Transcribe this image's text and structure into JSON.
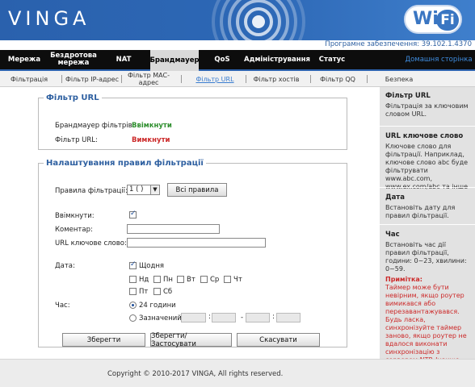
{
  "header": {
    "brand": "VINGA",
    "wifi_logo_wi": "Wi",
    "wifi_logo_fi": "Fi",
    "firmware": "Програмне забезпечення: 39.102.1.4370"
  },
  "topnav": {
    "items": [
      {
        "label": "Мережа"
      },
      {
        "label": "Бездротова мережа"
      },
      {
        "label": "NAT"
      },
      {
        "label": "Брандмауер"
      },
      {
        "label": "QoS"
      },
      {
        "label": "Адміністрування"
      },
      {
        "label": "Статус"
      }
    ],
    "home": "Домашня сторінка"
  },
  "subnav": {
    "items": [
      {
        "label": "Фільтрація"
      },
      {
        "label": "Фільтр IP-адрес"
      },
      {
        "label": "Фільтр MAC-адрес"
      },
      {
        "label": "Фільтр URL"
      },
      {
        "label": "Фільтр хостів"
      },
      {
        "label": "Фільтр QQ"
      },
      {
        "label": "Безпека"
      }
    ]
  },
  "url_filter": {
    "legend": "Фільтр URL",
    "firewall_label": "Брандмауер фільтрів:",
    "firewall_value": "Ввімкнути",
    "filter_label": "Фільтр URL:",
    "filter_value": "Вимкнути"
  },
  "rules": {
    "legend": "Налаштування правил фільтрації",
    "rule_label": "Правила фільтрації:",
    "rule_value": "1 ( )",
    "all_rules_btn": "Всі правила",
    "enable_label": "Ввімкнути:",
    "enable_checked": true,
    "comment_label": "Коментар:",
    "comment_value": "",
    "keyword_label": "URL ключове слово:",
    "keyword_value": "",
    "date_label": "Дата:",
    "daily_label": "Щодня",
    "daily_checked": true,
    "days": [
      "Нд",
      "Пн",
      "Вт",
      "Ср",
      "Чт",
      "Пт",
      "Сб"
    ],
    "time_label": "Час:",
    "time_24h": "24 години",
    "time_24h_selected": true,
    "time_custom": "Зазначений",
    "time_separator_colon": ":",
    "time_separator_dash": "-",
    "save_btn": "Зберегти",
    "save_apply_btn": "Зберегти/Застосувати",
    "cancel_btn": "Скасувати"
  },
  "help": {
    "sections": [
      {
        "title": "Фільтр URL",
        "text": "Фільтрація за ключовим словом URL."
      },
      {
        "title": "URL ключове слово",
        "text": "Ключове слово для фільтрації. Наприклад, ключове слово abc буде фільтрувати www.abc.com, www.ex.com/abc та інше"
      },
      {
        "title": "Дата",
        "text": "Встановіть дату для правил фільтрації."
      },
      {
        "title": "Час",
        "text": "Встановіть час дії правил фільтрації, години: 0~23, хвилини: 0~59."
      }
    ],
    "note_title": "Примітка:",
    "note_text": "Таймер може бути невірним, якщо роутер вимикався або перезавантажувався. Будь ласка, синхронізуйте таймер заново, якщо роутер не вдалося виконати синхронізацію з сервером NTP. Інакше контроль часу може не працювати."
  },
  "footer": {
    "copyright": "Copyright © 2010-2017 VINGA, All rights reserved."
  },
  "colors": {
    "header_blue": "#2a61ad",
    "nav_black": "#0d0d0d",
    "enabled_green": "#2f8f2f",
    "disabled_red": "#cc2a2a",
    "legend_blue": "#2d5fa0"
  }
}
